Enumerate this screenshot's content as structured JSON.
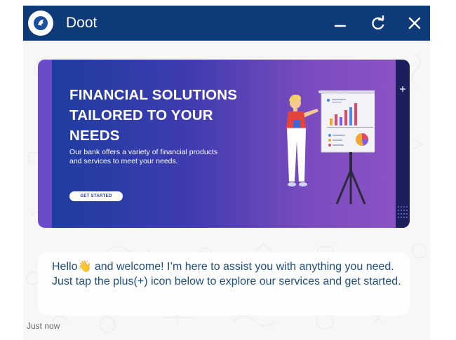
{
  "app": {
    "title": "Doot",
    "brand_color": "#0f3a7a"
  },
  "titlebar": {
    "minimize_icon": "minimize-icon",
    "refresh_icon": "refresh-icon",
    "close_icon": "close-icon"
  },
  "banner": {
    "title_line1": "FINANCIAL SOLUTIONS",
    "title_line2": "TAILORED TO YOUR",
    "title_line3": "NEEDS",
    "description": "Our bank offers a variety of financial products and services to meet your needs.",
    "cta_label": "GET STARTED"
  },
  "message": {
    "text_before_emoji": "Hello",
    "emoji": "👋",
    "text_after_emoji": " and welcome! I’m here to assist you with anything you need. Just tap the plus(+) icon below to explore our services and get started.",
    "timestamp": "Just now",
    "text_color": "#1f4f7c"
  }
}
